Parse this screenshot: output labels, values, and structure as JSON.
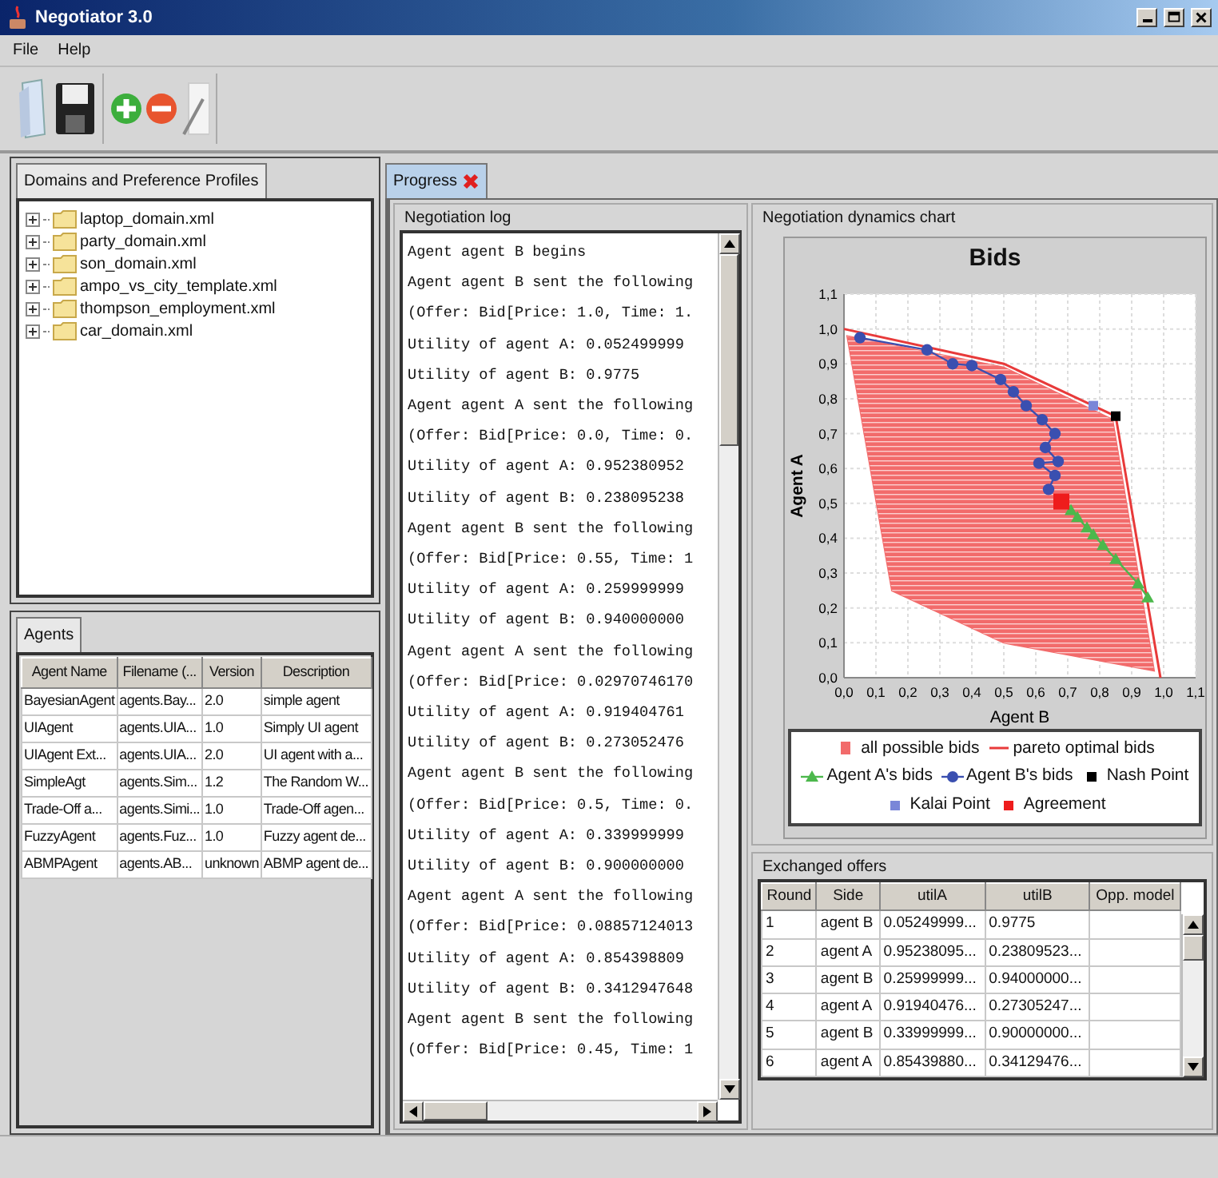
{
  "window": {
    "title": "Negotiator 3.0"
  },
  "menu": [
    "File",
    "Help"
  ],
  "domains": {
    "tabs": [
      {
        "label": "Domains and Preference Profiles",
        "selected": true
      }
    ],
    "items": [
      {
        "label": "laptop_domain.xml",
        "expanded": false
      },
      {
        "label": "party_domain.xml",
        "expanded": false
      },
      {
        "label": "son_domain.xml",
        "expanded": false
      },
      {
        "label": "ampo_vs_city_template.xml",
        "expanded": false
      },
      {
        "label": "thompson_employment.xml",
        "expanded": false
      },
      {
        "label": "car_domain.xml",
        "expanded": false
      }
    ]
  },
  "agents": {
    "tabs": [
      {
        "label": "Agents",
        "selected": true
      }
    ],
    "columns": [
      "Agent Name",
      "Filename (...",
      "Version",
      "Description"
    ],
    "rows": [
      [
        "BayesianAgent",
        "agents.Bay...",
        "2.0",
        "simple agent"
      ],
      [
        "UIAgent",
        "agents.UIA...",
        "1.0",
        "Simply UI agent"
      ],
      [
        "UIAgent Ext...",
        "agents.UIA...",
        "2.0",
        "UI agent with a..."
      ],
      [
        "SimpleAgt",
        "agents.Sim...",
        "1.2",
        "The Random W..."
      ],
      [
        "Trade-Off a...",
        "agents.Simi...",
        "1.0",
        "Trade-Off agen..."
      ],
      [
        "FuzzyAgent",
        "agents.Fuz...",
        "1.0",
        "Fuzzy agent de..."
      ],
      [
        "ABMPAgent",
        "agents.AB...",
        "unknown",
        "ABMP agent de..."
      ]
    ]
  },
  "progress_tabs": [
    {
      "label": "Progress",
      "selected": true
    }
  ],
  "log": {
    "title": "Negotiation log",
    "lines": [
      "Agent agent B begins",
      "Agent agent B sent the following",
      "(Offer: Bid[Price: 1.0, Time: 1.",
      "Utility of agent A: 0.052499999",
      "Utility of agent B: 0.9775",
      "Agent agent A sent the following",
      "(Offer: Bid[Price: 0.0, Time: 0.",
      "Utility of agent A: 0.952380952",
      "Utility of agent B: 0.238095238",
      "Agent agent B sent the following",
      "(Offer: Bid[Price: 0.55, Time: 1",
      "Utility of agent A: 0.259999999",
      "Utility of agent B: 0.940000000",
      "Agent agent A sent the following",
      "(Offer: Bid[Price: 0.02970746170",
      "Utility of agent A: 0.919404761",
      "Utility of agent B: 0.273052476",
      "Agent agent B sent the following",
      "(Offer: Bid[Price: 0.5, Time: 0.",
      "Utility of agent A: 0.339999999",
      "Utility of agent B: 0.900000000",
      "Agent agent A sent the following",
      "(Offer: Bid[Price: 0.08857124013",
      "Utility of agent A: 0.854398809",
      "Utility of agent B: 0.3412947648",
      "Agent agent B sent the following",
      "(Offer: Bid[Price: 0.45, Time: 1"
    ]
  },
  "chart": {
    "title": "Negotiation dynamics chart",
    "chart_data": {
      "type": "scatter",
      "title": "Bids",
      "xlabel": "Agent B",
      "ylabel": "Agent A",
      "xlim": [
        0,
        1.1
      ],
      "ylim": [
        0,
        1.1
      ],
      "xticks": [
        {
          "value": 0,
          "label": "0,0"
        },
        {
          "value": 0.1,
          "label": "0,1"
        },
        {
          "value": 0.2,
          "label": "0,2"
        },
        {
          "value": 0.3,
          "label": "0,3"
        },
        {
          "value": 0.4,
          "label": "0,4"
        },
        {
          "value": 0.5,
          "label": "0,5"
        },
        {
          "value": 0.6,
          "label": "0,6"
        },
        {
          "value": 0.7,
          "label": "0,7"
        },
        {
          "value": 0.8,
          "label": "0,8"
        },
        {
          "value": 0.9,
          "label": "0,9"
        },
        {
          "value": 1,
          "label": "1,0"
        },
        {
          "value": 1.1,
          "label": "1,1"
        }
      ],
      "yticks": [
        {
          "value": 0,
          "label": "0,0"
        },
        {
          "value": 0.1,
          "label": "0,1"
        },
        {
          "value": 0.2,
          "label": "0,2"
        },
        {
          "value": 0.3,
          "label": "0,3"
        },
        {
          "value": 0.4,
          "label": "0,4"
        },
        {
          "value": 0.5,
          "label": "0,5"
        },
        {
          "value": 0.6,
          "label": "0,6"
        },
        {
          "value": 0.7,
          "label": "0,7"
        },
        {
          "value": 0.8,
          "label": "0,8"
        },
        {
          "value": 0.9,
          "label": "0,9"
        },
        {
          "value": 1,
          "label": "1,0"
        },
        {
          "value": 1.1,
          "label": "1,1"
        }
      ],
      "grid": true,
      "legend": true,
      "series": [
        {
          "name": "all possible bids",
          "type": "area",
          "color": "#f26b6b",
          "x": [
            0.01,
            0.5,
            0.84,
            0.97,
            0.5,
            0.15
          ],
          "values": [
            0.98,
            0.89,
            0.74,
            0.02,
            0.1,
            0.25
          ]
        },
        {
          "name": "pareto optimal bids",
          "type": "line",
          "color": "#e83a3a",
          "x": [
            0,
            0.5,
            0.85,
            0.99
          ],
          "values": [
            1,
            0.9,
            0.75,
            0
          ]
        },
        {
          "name": "Agent A's bids",
          "type": "line",
          "marker": "triangle",
          "color": "#4cb84c",
          "x": [
            0.71,
            0.73,
            0.76,
            0.78,
            0.81,
            0.85,
            0.92,
            0.95
          ],
          "values": [
            0.48,
            0.46,
            0.43,
            0.41,
            0.38,
            0.34,
            0.27,
            0.23
          ]
        },
        {
          "name": "Agent B's bids",
          "type": "line",
          "marker": "circle",
          "color": "#3a4fb0",
          "x": [
            0.05,
            0.26,
            0.34,
            0.4,
            0.49,
            0.53,
            0.57,
            0.62,
            0.66,
            0.63,
            0.67,
            0.61,
            0.66,
            0.64
          ],
          "values": [
            0.975,
            0.94,
            0.9,
            0.895,
            0.855,
            0.82,
            0.78,
            0.74,
            0.7,
            0.66,
            0.62,
            0.615,
            0.58,
            0.54
          ]
        },
        {
          "name": "Nash Point",
          "marker": "square",
          "color": "#000000",
          "x": [
            0.85
          ],
          "values": [
            0.75
          ]
        },
        {
          "name": "Kalai Point",
          "marker": "square",
          "color": "#7a86d8",
          "x": [
            0.78
          ],
          "values": [
            0.78
          ]
        },
        {
          "name": "Agreement",
          "marker": "square",
          "color": "#ee1c1c",
          "x": [
            0.68
          ],
          "values": [
            0.505
          ]
        }
      ]
    }
  },
  "offers": {
    "title": "Exchanged offers",
    "columns": [
      "Round",
      "Side",
      "utilA",
      "utilB",
      "Opp. model"
    ],
    "rows": [
      [
        "1",
        "agent B",
        "0.05249999...",
        "0.9775"
      ],
      [
        "2",
        "agent A",
        "0.95238095...",
        "0.23809523..."
      ],
      [
        "3",
        "agent B",
        "0.25999999...",
        "0.94000000..."
      ],
      [
        "4",
        "agent A",
        "0.91940476...",
        "0.27305247..."
      ],
      [
        "5",
        "agent B",
        "0.33999999...",
        "0.90000000..."
      ],
      [
        "6",
        "agent A",
        "0.85439880...",
        "0.34129476..."
      ]
    ]
  }
}
